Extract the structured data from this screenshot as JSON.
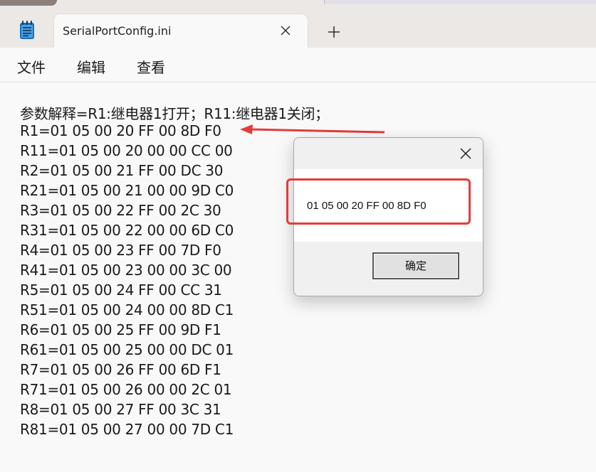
{
  "window": {
    "tab_title": "SerialPortConfig.ini",
    "icons": {
      "app": "notepad-icon",
      "close": "close-icon",
      "new_tab": "plus-icon"
    }
  },
  "menu": {
    "items": [
      "文件",
      "编辑",
      "查看"
    ]
  },
  "editor": {
    "lines": [
      "参数解释=R1:继电器1打开；R11:继电器1关闭；",
      "R1=01 05 00 20 FF 00 8D F0",
      "R11=01 05 00 20 00 00 CC 00",
      "R2=01 05 00 21 FF 00 DC 30",
      "R21=01 05 00 21 00 00 9D C0",
      "R3=01 05 00 22 FF 00 2C 30",
      "R31=01 05 00 22 00 00 6D C0",
      "R4=01 05 00 23 FF 00 7D F0",
      "R41=01 05 00 23 00 00 3C 00",
      "R5=01 05 00 24 FF 00 CC 31",
      "R51=01 05 00 24 00 00 8D C1",
      "R6=01 05 00 25 FF 00 9D F1",
      "R61=01 05 00 25 00 00 DC 01",
      "R7=01 05 00 26 FF 00 6D F1",
      "R71=01 05 00 26 00 00 2C 01",
      "R8=01 05 00 27 FF 00 3C 31",
      "R81=01 05 00 27 00 00 7D C1"
    ]
  },
  "dialog": {
    "message": "01 05 00 20 FF 00 8D F0",
    "ok_label": "确定"
  },
  "annotation": {
    "color": "#e53b3b"
  }
}
